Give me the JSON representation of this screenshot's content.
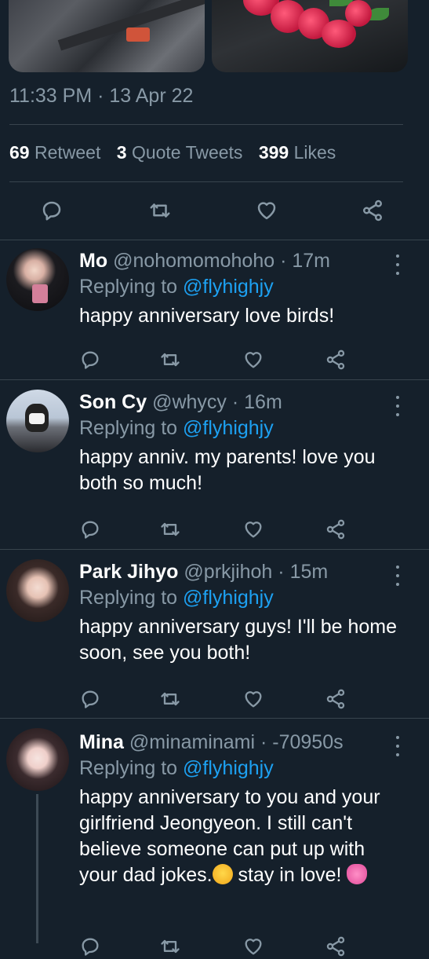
{
  "tweet": {
    "timestamp": "11:33 PM · 13 Apr 22",
    "stats": {
      "retweets_count": "69",
      "retweets_label": "Retweet",
      "quotes_count": "3",
      "quotes_label": "Quote Tweets",
      "likes_count": "399",
      "likes_label": "Likes"
    }
  },
  "icons": {
    "reply": "reply-icon",
    "retweet": "retweet-icon",
    "like": "heart-icon",
    "share": "share-icon",
    "more": "more-vertical-icon"
  },
  "colors": {
    "background": "#15202b",
    "muted": "#8899a6",
    "link": "#1da1f2",
    "divider": "#38444d"
  },
  "replies": [
    {
      "name": "Mo",
      "handle": "@nohomomohoho",
      "time": "· 17m",
      "replying_label": "Replying to",
      "replying_to": "@flyhighjy",
      "text": "happy anniversary love birds!"
    },
    {
      "name": "Son Cy",
      "handle": "@whycy",
      "time": "· 16m",
      "replying_label": "Replying to",
      "replying_to": "@flyhighjy",
      "text": "happy anniv. my parents! love you both so much!"
    },
    {
      "name": "Park Jihyo",
      "handle": "@prkjihoh",
      "time": "· 15m",
      "replying_label": "Replying to",
      "replying_to": "@flyhighjy",
      "text": "happy anniversary guys! I'll be home soon, see you both!"
    },
    {
      "name": "Mina",
      "handle": "@minaminami",
      "time": "· -70950s",
      "replying_label": "Replying to",
      "replying_to": "@flyhighjy",
      "text_part1": "happy anniversary to you and your girlfriend Jeongyeon. I still can't believe someone can put up with your dad jokes.",
      "text_part2": " stay in love! "
    }
  ]
}
